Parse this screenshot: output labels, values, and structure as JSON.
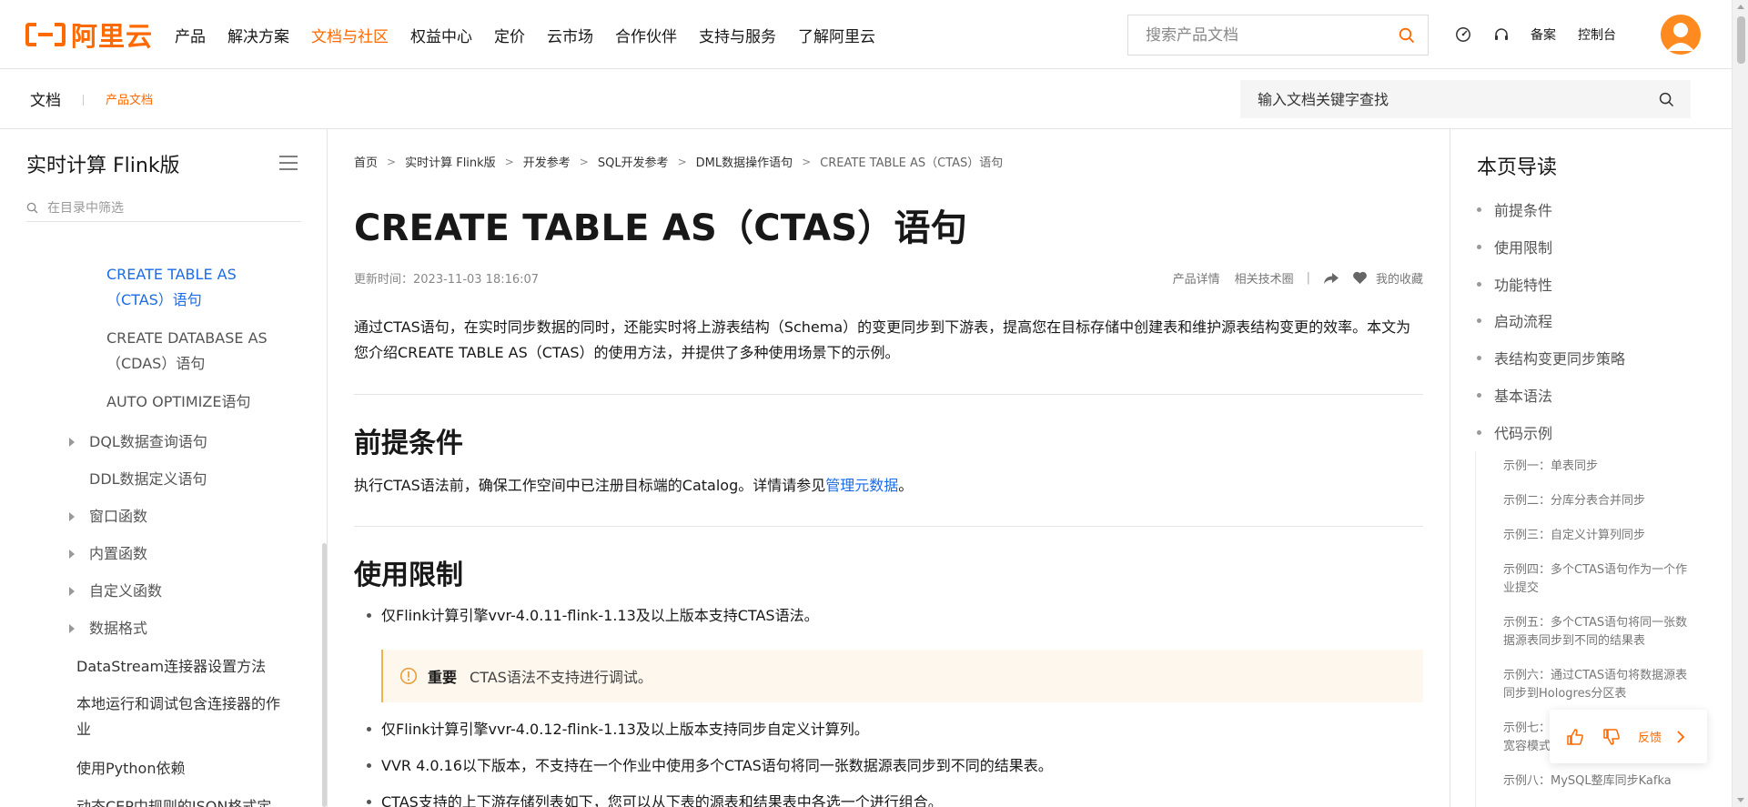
{
  "brand": {
    "logo_text": "阿里云",
    "accent": "#ff6a00",
    "link_color": "#1b6ce8"
  },
  "topnav": {
    "items": [
      "产品",
      "解决方案",
      "文档与社区",
      "权益中心",
      "定价",
      "云市场",
      "合作伙伴",
      "支持与服务",
      "了解阿里云"
    ],
    "active_item": "文档与社区",
    "search_placeholder": "搜索产品文档",
    "right_links": [
      "备案",
      "控制台"
    ]
  },
  "subnav": {
    "doc_label": "文档",
    "product_docs": "产品文档",
    "search_placeholder": "输入文档关键字查找"
  },
  "sidebar": {
    "title": "实时计算 Flink版",
    "filter_placeholder": "在目录中筛选",
    "items": [
      "CREATE TABLE AS\n（CTAS）语句",
      "CREATE DATABASE AS\n（CDAS）语句",
      "AUTO OPTIMIZE语句",
      "DQL数据查询语句",
      "DDL数据定义语句",
      "窗口函数",
      "内置函数",
      "自定义函数",
      "数据格式",
      "DataStream连接器设置方法",
      "本地运行和调试包含连接器的作\n业",
      "使用Python依赖",
      "动态CEP中规则的JSON格式定"
    ]
  },
  "breadcrumb": [
    "首页",
    "实时计算 Flink版",
    "开发参考",
    "SQL开发参考",
    "DML数据操作语句",
    "CREATE TABLE AS（CTAS）语句"
  ],
  "article": {
    "title": "CREATE TABLE AS（CTAS）语句",
    "updated": "更新时间：2023-11-03 18:16:07",
    "meta_links": [
      "产品详情",
      "相关技术圈",
      "我的收藏"
    ],
    "meta_divider": "|",
    "intro": "通过CTAS语句，在实时同步数据的同时，还能实时将上游表结构（Schema）的变更同步到下游表，提高您在目标存储中创建表和维护源表结构变更的效率。本文为您介绍CREATE TABLE AS（CTAS）的使用方法，并提供了多种使用场景下的示例。",
    "sections": [
      {
        "heading": "前提条件",
        "text_before": "执行CTAS语法前，确保工作空间中已注册目标端的Catalog。详情请参见",
        "link": "管理元数据",
        "text_after": "。"
      },
      {
        "heading": "使用限制",
        "bullets": [
          "仅Flink计算引擎vvr-4.0.11-flink-1.13及以上版本支持CTAS语法。",
          "仅Flink计算引擎vvr-4.0.12-flink-1.13及以上版本支持同步自定义计算列。",
          "VVR 4.0.16以下版本，不支持在一个作业中使用多个CTAS语句将同一张数据源表同步到不同的结果表。",
          "CTAS支持的上下游存储列表如下，您可以从下表的源表和结果表中各选一个进行组合。"
        ],
        "notice": {
          "title": "重要",
          "text": "CTAS语法不支持进行调试。"
        }
      }
    ]
  },
  "toc": {
    "title": "本页导读",
    "items": [
      "前提条件",
      "使用限制",
      "功能特性",
      "启动流程",
      "表结构变更同步策略",
      "基本语法",
      "代码示例"
    ],
    "subitems": [
      "示例一：单表同步",
      "示例二：分库分表合并同步",
      "示例三：自定义计算列同步",
      "示例四：多个CTAS语句作为一个作业提交",
      "示例五：多个CTAS语句将同一张数据源表同步到不同的结果表",
      "示例六：通过CTAS语句将数据源表同步到Hologres分区表",
      "示例七：",
      "宽容模式",
      "示例八：MySQL整库同步Kafka"
    ]
  },
  "feedback": {
    "label": "反馈"
  },
  "icons": [
    "logo-icon",
    "search-icon",
    "dashboard-icon",
    "headset-icon",
    "avatar",
    "list-menu-icon",
    "filter-search-icon",
    "tree-arrow-icon",
    "share-icon",
    "heart-icon",
    "warning-icon",
    "thumb-up-icon",
    "thumb-down-icon",
    "chevron-right-icon"
  ]
}
